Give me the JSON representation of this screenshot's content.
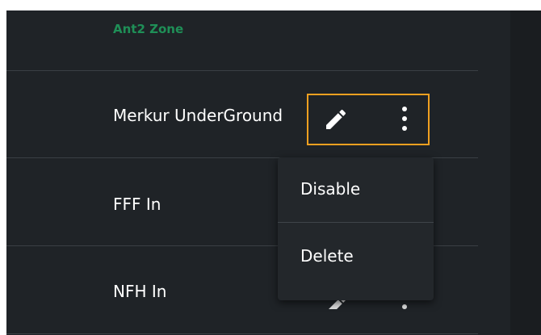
{
  "zone": {
    "title": "Ant2 Zone"
  },
  "rows": [
    {
      "label": "Merkur UnderGround"
    },
    {
      "label": "FFF In"
    },
    {
      "label": "NFH In"
    }
  ],
  "icons": {
    "edit": "pencil-icon",
    "more": "more-vert-icon"
  },
  "menu": {
    "items": [
      {
        "label": "Disable"
      },
      {
        "label": "Delete"
      }
    ]
  },
  "colors": {
    "background": "#1f2327",
    "accent_green": "#1f8f57",
    "focus_border": "#f0a020",
    "text": "#ffffff"
  }
}
